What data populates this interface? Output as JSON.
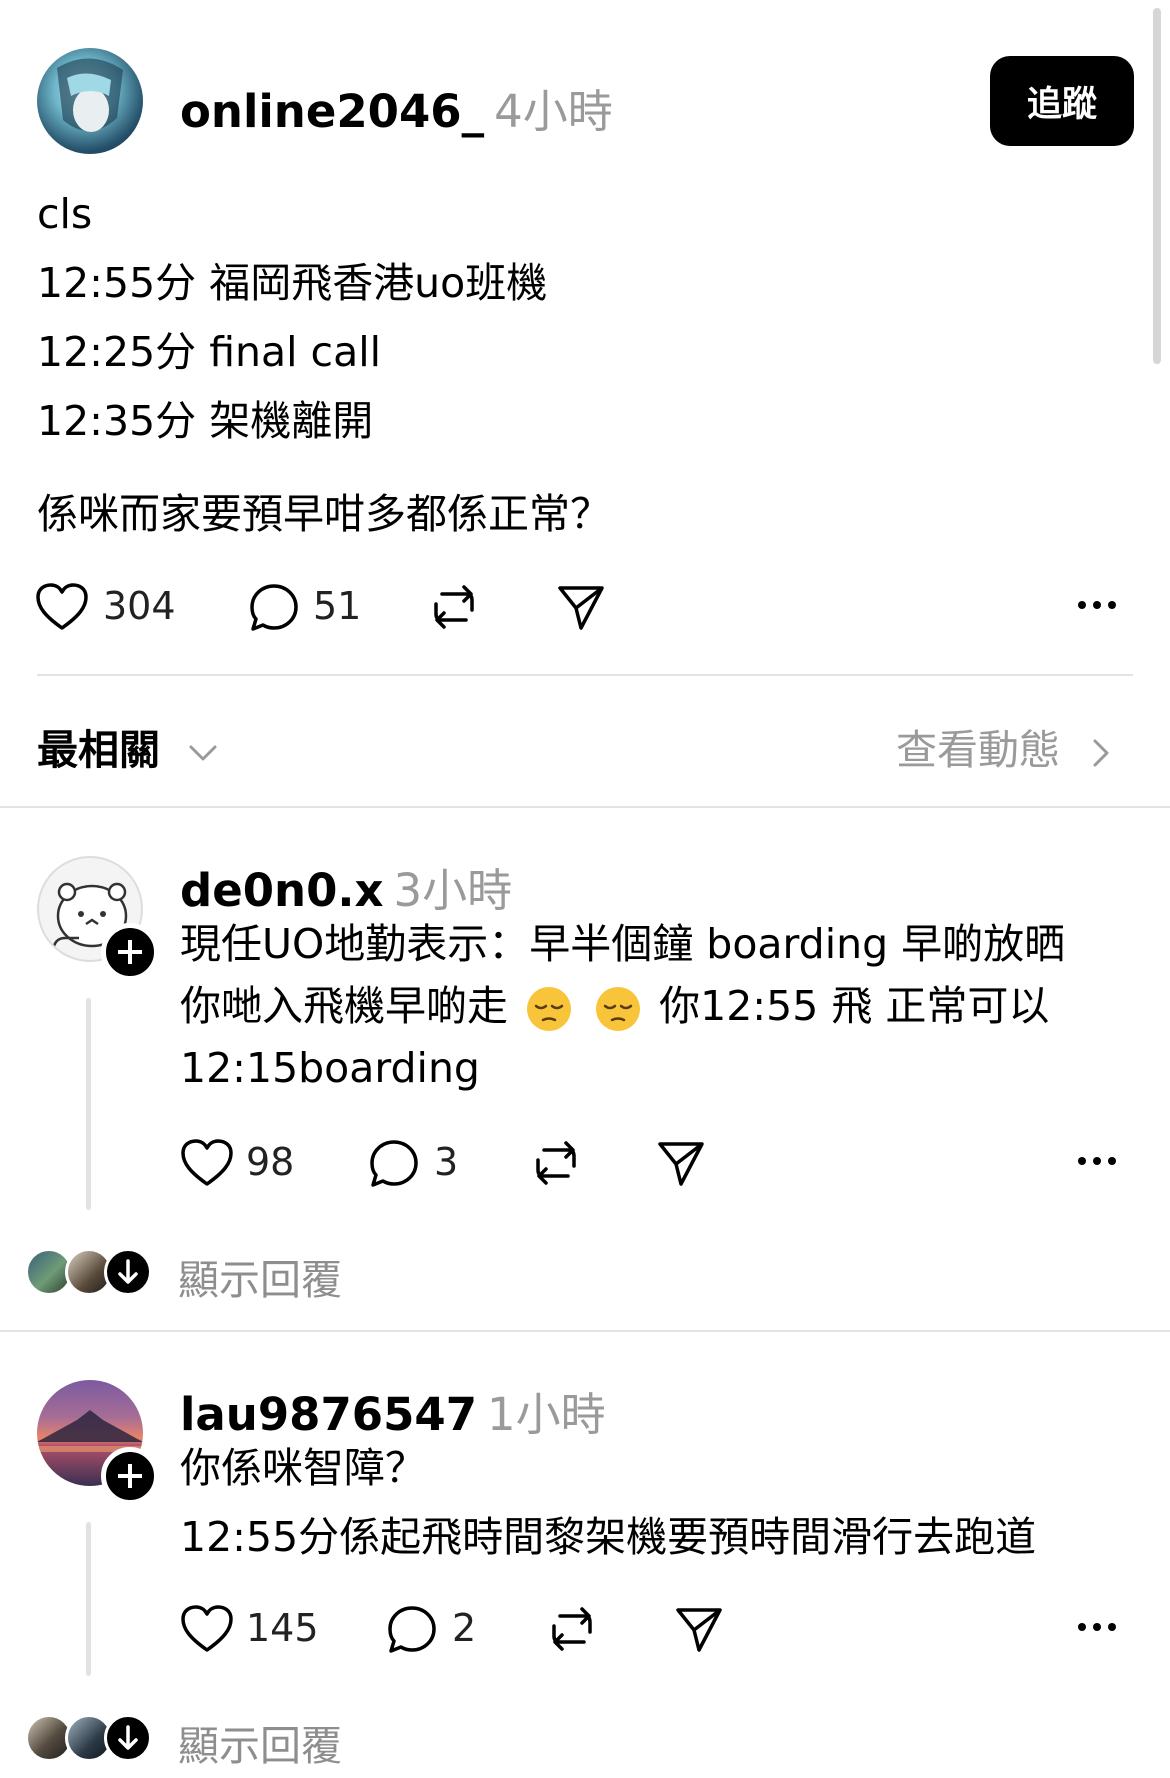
{
  "post": {
    "username": "online2046_",
    "time": "4小時",
    "follow_label": "追蹤",
    "lines": [
      "cls",
      "12:55分 福岡飛香港uo班機",
      "12:25分 final call",
      "12:35分 架機離開"
    ],
    "question": "係咪而家要預早咁多都係正常？",
    "likes": "304",
    "comments": "51"
  },
  "sort": {
    "label": "最相關",
    "activity_link": "查看動態"
  },
  "replies": [
    {
      "username": "de0n0.x",
      "time": "3小時",
      "line1": "現任UO地勤表示：早半個鐘 boarding 早啲放晒",
      "line2_a": "你哋入飛機早啲走",
      "line2_b": "你12:55 飛 正常可以",
      "line3": "12:15boarding",
      "likes": "98",
      "comments": "3",
      "show_replies": "顯示回覆"
    },
    {
      "username": "lau9876547",
      "time": "1小時",
      "line1": "你係咪智障？",
      "line2": "12:55分係起飛時間黎架機要預時間滑行去跑道",
      "likes": "145",
      "comments": "2",
      "show_replies": "顯示回覆"
    }
  ],
  "colors": {
    "text": "#000000",
    "muted": "#9a9a9a",
    "divider": "#e3e3e3",
    "follow_bg": "#000000",
    "follow_text": "#ffffff"
  },
  "icons": [
    "heart-icon",
    "comment-icon",
    "repost-icon",
    "share-icon",
    "more-icon",
    "chevron-down-icon",
    "chevron-right-icon",
    "plus-icon",
    "arrow-down-icon",
    "pensive-face-emoji"
  ]
}
